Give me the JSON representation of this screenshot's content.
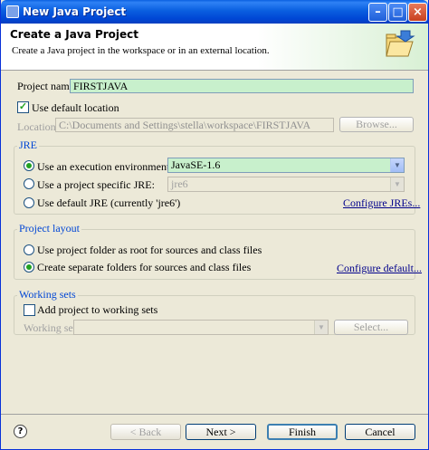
{
  "window": {
    "title": "New Java Project",
    "minimize_icon": "minimize-icon",
    "maximize_icon": "maximize-icon",
    "close_icon": "close-icon"
  },
  "header": {
    "title": "Create a Java Project",
    "description": "Create a Java project in the workspace or in an external location.",
    "icon": "open-folder-icon"
  },
  "project_name": {
    "label": "Project name:",
    "value": "FIRSTJAVA"
  },
  "location": {
    "use_default_label": "Use default location",
    "use_default_checked": true,
    "label": "Location:",
    "value": "C:\\Documents and Settings\\stella\\workspace\\FIRSTJAVA",
    "browse_label": "Browse..."
  },
  "jre": {
    "group_title": "JRE",
    "option_env_label": "Use an execution environment JRE:",
    "option_env_value": "JavaSE-1.6",
    "option_specific_label": "Use a project specific JRE:",
    "option_specific_value": "jre6",
    "option_default_label": "Use default JRE (currently 'jre6')",
    "configure_link": "Configure JREs...",
    "selected": "env"
  },
  "layout": {
    "group_title": "Project layout",
    "option_root_label": "Use project folder as root for sources and class files",
    "option_separate_label": "Create separate folders for sources and class files",
    "configure_link": "Configure default...",
    "selected": "separate"
  },
  "working_sets": {
    "group_title": "Working sets",
    "add_label": "Add project to working sets",
    "add_checked": false,
    "label": "Working sets:",
    "value": "",
    "select_label": "Select..."
  },
  "footer": {
    "help_icon": "help-icon",
    "back_label": "< Back",
    "next_label": "Next >",
    "finish_label": "Finish",
    "cancel_label": "Cancel"
  }
}
